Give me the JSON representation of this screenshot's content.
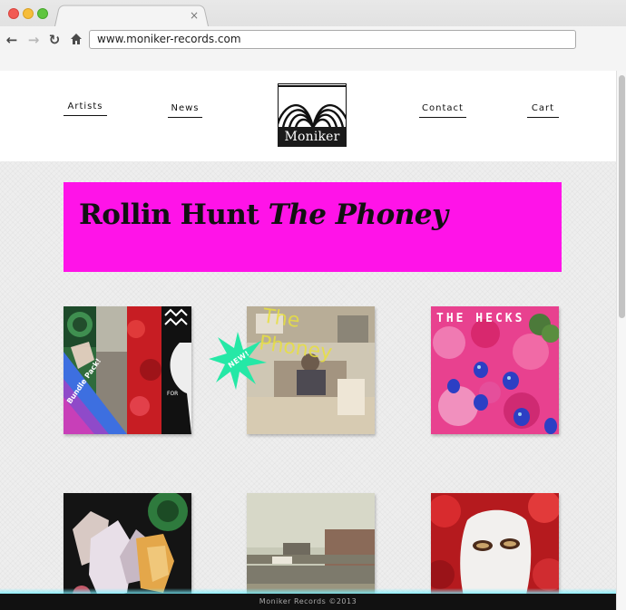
{
  "browser": {
    "tab_close": "×",
    "back_icon": "arrow-left-icon",
    "forward_icon": "arrow-right-icon",
    "reload_icon": "reload-icon",
    "home_icon": "home-icon",
    "url": "www.moniker-records.com"
  },
  "nav": {
    "artists": "Artists",
    "news": "News",
    "contact": "Contact",
    "cart": "Cart"
  },
  "logo": {
    "text": "Moniker"
  },
  "banner": {
    "artist": "Rollin Hunt",
    "album": "The Phoney",
    "color": "#ff13e8"
  },
  "releases": [
    {
      "label": "Bundle Pack!",
      "extra": "FOR"
    },
    {
      "badge": "NEW!",
      "cover_text": "The Phoney"
    },
    {
      "cover_text": "THE HECKS"
    },
    {},
    {},
    {}
  ],
  "footer": {
    "text": "Moniker Records ©2013"
  },
  "colors": {
    "accent": "#ff13e8",
    "badge": "#25e8a6",
    "footer_bg": "#111111"
  }
}
